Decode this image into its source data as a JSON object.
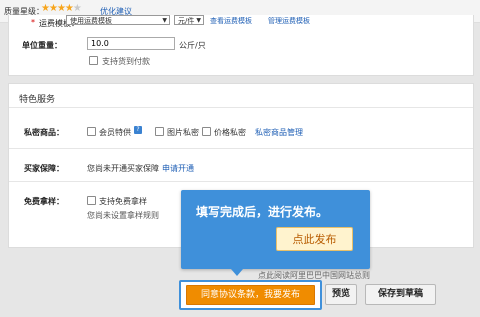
{
  "top": {
    "rating_label": "质量星级：",
    "stars_filled": 4,
    "stars_total": 5,
    "suggest_link": "优化建议"
  },
  "logistics": {
    "cut_label": "运费模板：",
    "template_select": "使用运费模板",
    "unit_select": "元/件",
    "link_1": "查看运费模板",
    "link_2": "管理运费模板",
    "weight_label": "单位重量：",
    "weight_value": "10.0",
    "weight_unit": "公斤/只",
    "cod_label": "支持货到付款"
  },
  "special": {
    "title": "特色服务",
    "private_label": "私密商品：",
    "opt_member": "会员特供",
    "help_icon_text": "?",
    "opt_image": "图片私密",
    "opt_price": "价格私密",
    "manage_link": "私密商品管理",
    "guarantee_label": "买家保障：",
    "guarantee_text": "您尚未开通买家保障",
    "apply_link": "申请开通",
    "sample_label": "免费拿样：",
    "sample_opt": "支持免费拿样",
    "sample_note": "您尚未设置拿样规则"
  },
  "popup": {
    "message": "填写完成后，进行发布。",
    "action": "点此发布"
  },
  "footer": {
    "agree_text": "点此阅读阿里巴巴中国网站总则",
    "submit_label": "同意协议条款，我要发布",
    "preview_label": "预览",
    "draft_label": "保存到草稿"
  }
}
